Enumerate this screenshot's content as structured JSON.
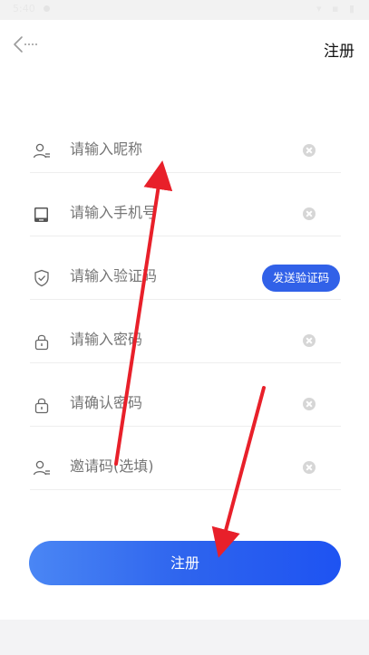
{
  "status_bar": {
    "time": "5:40",
    "right_glyphs": "▾ ▪ ▮"
  },
  "header": {
    "back_icon": "back-arrow-icon",
    "action_label": "注册"
  },
  "form": {
    "nickname": {
      "icon": "user-icon",
      "placeholder": "请输入昵称"
    },
    "phone": {
      "icon": "phone-icon",
      "placeholder": "请输入手机号"
    },
    "code": {
      "icon": "shield-icon",
      "placeholder": "请输入验证码",
      "send_label": "发送验证码"
    },
    "password": {
      "icon": "lock-icon",
      "placeholder": "请输入密码"
    },
    "confirm": {
      "icon": "lock-icon",
      "placeholder": "请确认密码"
    },
    "invite": {
      "icon": "user-icon",
      "placeholder": "邀请码(选填)"
    }
  },
  "submit_label": "注册",
  "colors": {
    "accent": "#2e64ee",
    "arrow": "#e8202a",
    "placeholder": "#7d7d7d"
  }
}
